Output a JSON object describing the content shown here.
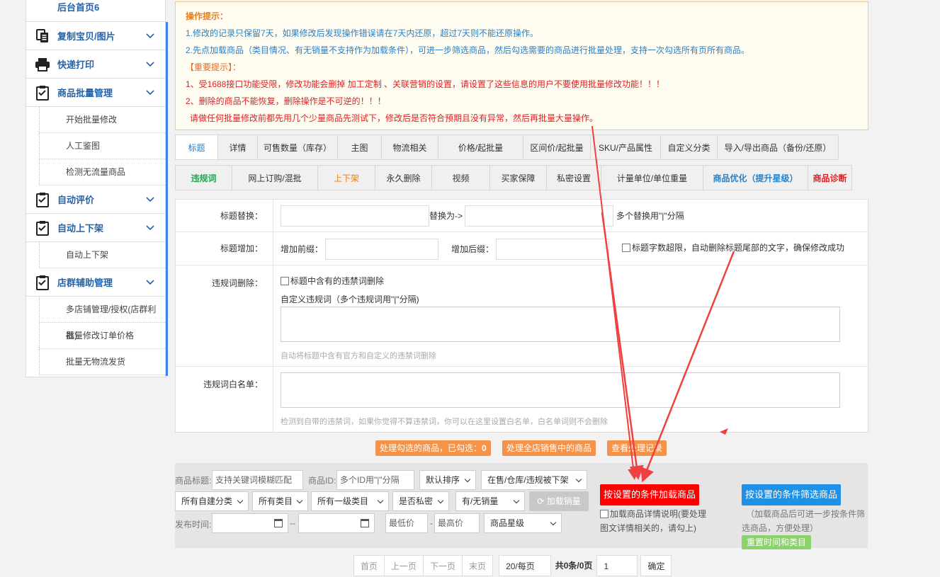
{
  "sidebar": {
    "top_item": "后台首页6",
    "groups": [
      {
        "label": "复制宝贝/图片",
        "icon": "copy-icon"
      },
      {
        "label": "快递打印",
        "icon": "printer-icon"
      },
      {
        "label": "商品批量管理",
        "icon": "clipboard-icon",
        "children": [
          "开始批量修改",
          "人工鉴图",
          "检测无流量商品"
        ]
      },
      {
        "label": "自动评价",
        "icon": "clipboard-icon"
      },
      {
        "label": "自动上下架",
        "icon": "clipboard-icon",
        "children": [
          "自动上下架"
        ]
      },
      {
        "label": "店群辅助管理",
        "icon": "clipboard-icon",
        "children": [
          "多店铺管理/授权(店群利器)",
          "批量修改订单价格",
          "批量无物流发货"
        ]
      }
    ]
  },
  "tips": {
    "title": "操作提示：",
    "line1": "1.修改的记录只保留7天，如果修改后发现操作错误请在7天内还原，超过7天则不能还原操作。",
    "line2": "2.先点加载商品（类目情况、有无销量不支持作为加载条件），可进一步筛选商品，然后勾选需要的商品进行批量处理，支持一次勾选所有页所有商品。",
    "important": "【重要提示】：",
    "red1": "1、受1688接口功能受限，修改功能会删掉 加工定制 、关联营销的设置，请设置了这些信息的用户不要使用批量修改功能！！！",
    "red2": "2、删除的商品不能恢复，删除操作是不可逆的！！！",
    "red3": "请做任何批量修改前都先用几个少量商品先测试下，修改后是否符合预期且没有异常，然后再批量大量操作。"
  },
  "tabs1": [
    "标题",
    "详情",
    "可售数量（库存）",
    "主图",
    "物流相关",
    "价格/起批量",
    "区间价/起批量",
    "SKU/产品属性",
    "自定义分类",
    "导入/导出商品（备份/还原）"
  ],
  "tabs2": [
    "违规词",
    "网上订购/混批",
    "上下架",
    "永久删除",
    "视频",
    "买家保障",
    "私密设置",
    "计量单位/单位重量",
    "商品优化（提升星级）",
    "商品诊断"
  ],
  "form": {
    "replace_label": "标题替换：",
    "replace_to": "替换为->",
    "replace_hint": "多个替换用\"|\"分隔",
    "add_label": "标题增加：",
    "prefix": "增加前缀：",
    "suffix": "增加后缀：",
    "overflow_cb": "标题字数超限，自动删除标题尾部的文字，确保修改成功",
    "violate_label": "违规词删除：",
    "violate_cb": "标题中含有的违禁词删除",
    "custom_words": "自定义违规词（多个违规词用\"|\"分隔)",
    "violate_hint": "自动将标题中含有官方和自定义的违禁词删除",
    "white_label": "违规词白名单：",
    "white_hint": "检测到自带的违禁词，如果你觉得不算违禁词，你可以在这里设置白名单，白名单词则不会删除"
  },
  "actions": {
    "selected": "处理勾选的商品，已勾选：",
    "selected_count": "0",
    "all": "处理全店销售中的商品",
    "log": "查看处理记录"
  },
  "filter": {
    "title_label": "商品标题:",
    "title_ph": "支持关键词模糊匹配",
    "id_label": "商品ID:",
    "id_ph": "多个ID用\"|\"分隔",
    "sort": "默认排序",
    "status": "在售/仓库/违规被下架",
    "cat_custom": "所有自建分类",
    "cat_all": "所有类目",
    "cat_first": "所有一级类目",
    "private": "是否私密",
    "sales": "有/无销量",
    "load_sales": "加载销量",
    "date_label": "发布时间:",
    "dash": "--",
    "min_price": "最低价",
    "dash2": "-",
    "max_price": "最高价",
    "star": "商品星级",
    "load_btn": "按设置的条件加载商品",
    "detail_cb": "加载商品详情说明(要处理图文详情相关的，请勾上)",
    "filter_btn": "按设置的条件筛选商品",
    "filter_note": "（加载商品后可进一步按条件筛选商品，方便处理）",
    "reset_btn": "重置时间和类目"
  },
  "pager": {
    "first": "首页",
    "prev": "上一页",
    "next": "下一页",
    "last": "末页",
    "per": "20/每页",
    "total": "共0条/0页",
    "page": "1",
    "ok": "确定"
  },
  "colors": {
    "accent": "#2a82c8",
    "orange": "#f6934a",
    "red": "#ff0000",
    "blue": "#1e90e6",
    "green": "#8cd26b",
    "annotation": "#f04040"
  }
}
